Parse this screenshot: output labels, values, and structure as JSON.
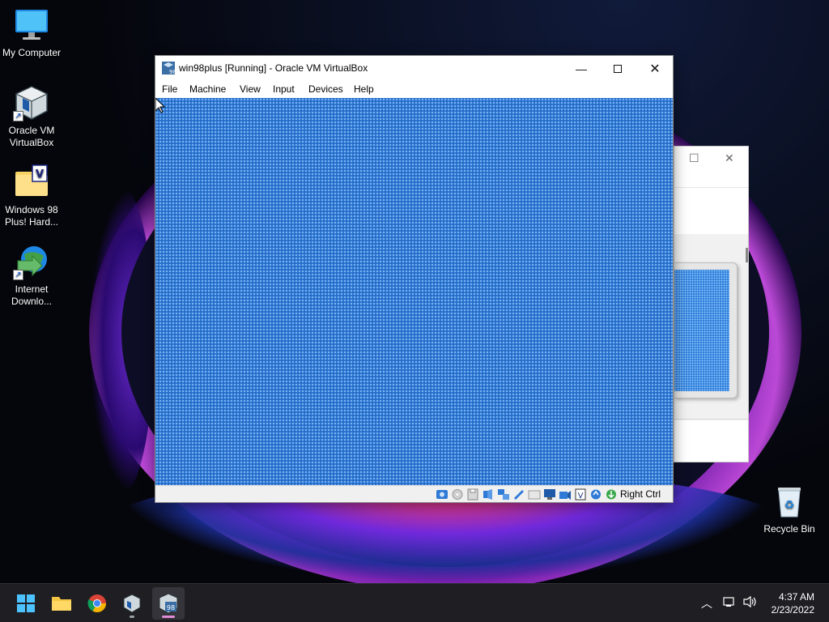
{
  "desktop": {
    "icons": [
      {
        "label": "My Computer",
        "icon": "monitor-icon"
      },
      {
        "label": "Oracle VM VirtualBox",
        "icon": "virtualbox-icon"
      },
      {
        "label": "Windows 98 Plus! Hard...",
        "icon": "folder-icon"
      },
      {
        "label": "Internet Downlo...",
        "icon": "internet-download-manager-icon"
      }
    ],
    "recycle_bin": {
      "label": "Recycle Bin",
      "icon": "recycle-bin-icon"
    }
  },
  "vm_window": {
    "title": "win98plus [Running] - Oracle VM VirtualBox",
    "menu": [
      "File",
      "Machine",
      "View",
      "Input",
      "Devices",
      "Help"
    ],
    "host_key": "Right Ctrl",
    "status_icons": [
      "hard-disk-icon",
      "optical-drive-icon",
      "floppy-icon",
      "audio-icon",
      "network-icon",
      "usb-icon",
      "shared-folder-icon",
      "display-icon",
      "recording-icon",
      "cpu-icon",
      "mouse-integration-icon",
      "keyboard-icon"
    ],
    "accent_color": "#2f7ad6"
  },
  "taskbar": {
    "apps": [
      "start-icon",
      "file-explorer-icon",
      "chrome-icon",
      "virtualbox-icon",
      "win98-vm-icon"
    ],
    "tray": [
      "chevron-up-icon",
      "network-icon",
      "volume-icon"
    ],
    "time": "4:37 AM",
    "date": "2/23/2022"
  }
}
